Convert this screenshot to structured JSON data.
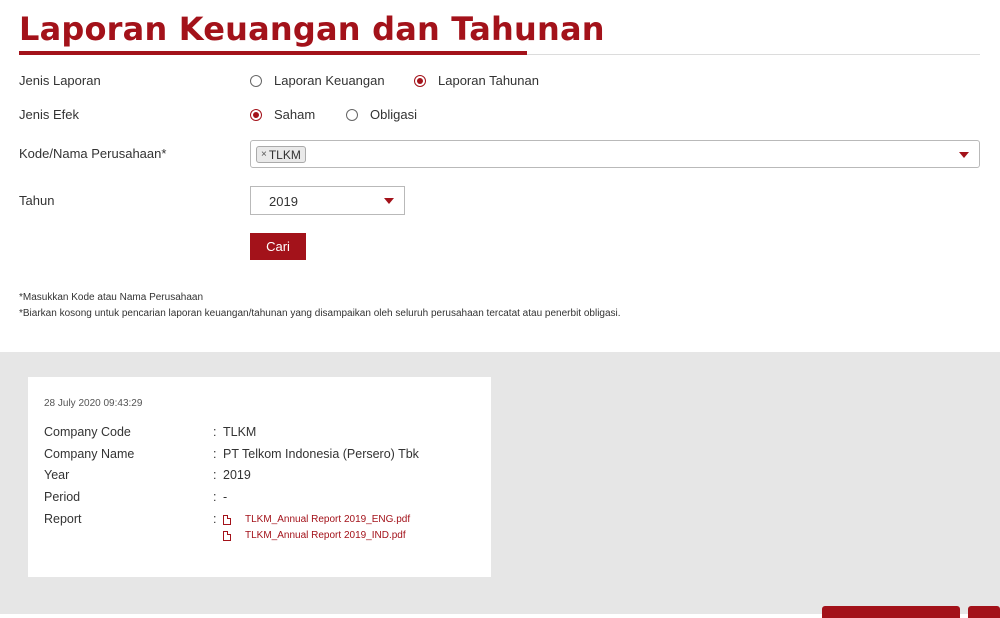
{
  "page": {
    "title": "Laporan Keuangan dan Tahunan"
  },
  "form": {
    "jenis_laporan": {
      "label": "Jenis Laporan",
      "options": [
        "Laporan Keuangan",
        "Laporan Tahunan"
      ],
      "selected": "Laporan Tahunan"
    },
    "jenis_efek": {
      "label": "Jenis Efek",
      "options": [
        "Saham",
        "Obligasi"
      ],
      "selected": "Saham"
    },
    "kode": {
      "label": "Kode/Nama Perusahaan*",
      "chip_remove": "×",
      "chips": [
        "TLKM"
      ]
    },
    "tahun": {
      "label": "Tahun",
      "value": "2019"
    },
    "submit_label": "Cari"
  },
  "notes": [
    "*Masukkan Kode atau Nama Perusahaan",
    "*Biarkan kosong untuk pencarian laporan keuangan/tahunan yang disampaikan oleh seluruh perusahaan tercatat atau penerbit obligasi."
  ],
  "result": {
    "timestamp": "28 July 2020 09:43:29",
    "colon": ":",
    "rows": [
      {
        "label": "Company Code",
        "value": "TLKM"
      },
      {
        "label": "Company Name",
        "value": "PT Telkom Indonesia (Persero) Tbk"
      },
      {
        "label": "Year",
        "value": "2019"
      },
      {
        "label": "Period",
        "value": "-"
      },
      {
        "label": "Report",
        "value": ""
      }
    ],
    "reports": [
      "TLKM_Annual Report 2019_ENG.pdf",
      "TLKM_Annual Report 2019_IND.pdf"
    ]
  },
  "icons": {
    "report_file": "pdf-file-icon",
    "dropdown": "caret-down-icon"
  },
  "colors": {
    "accent": "#a3121a",
    "section_bg": "#e6e6e6"
  }
}
